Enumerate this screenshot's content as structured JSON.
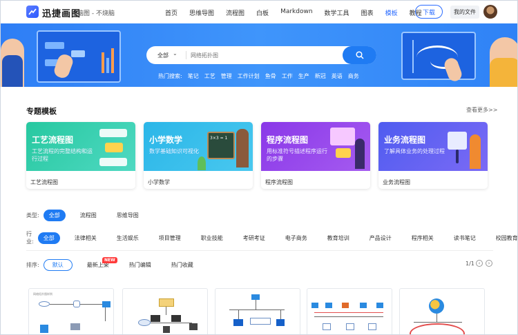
{
  "header": {
    "brand": "迅捷画图",
    "slogan": "脑图 - 不烧脑",
    "nav": [
      "首页",
      "思维导图",
      "流程图",
      "白板",
      "Markdown",
      "数学工具",
      "图表",
      "模板",
      "教程"
    ],
    "active_nav": "模板",
    "download_label": "下载",
    "my_files_label": "我的文件"
  },
  "search": {
    "scope": "全部",
    "placeholder": "网络拓扑图",
    "hot_label": "热门搜索:",
    "hot_tags": [
      "笔记",
      "工艺",
      "管理",
      "工作计划",
      "鱼骨",
      "工作",
      "生产",
      "新冠",
      "英语",
      "商务"
    ]
  },
  "section": {
    "title": "专题模板",
    "more": "查看更多>>"
  },
  "cards": [
    {
      "title": "工艺流程图",
      "desc": "工艺流程的完整结构和运行过程",
      "caption": "工艺流程图"
    },
    {
      "title": "小学数学",
      "desc": "数学基础知识可视化",
      "caption": "小学数学"
    },
    {
      "title": "程序流程图",
      "desc": "用标准符号描述程序运行的步骤",
      "caption": "程序流程图"
    },
    {
      "title": "业务流程图",
      "desc": "了解具体业务的处理过程",
      "caption": "业务流程图"
    }
  ],
  "filters": {
    "type_label": "类型:",
    "types": [
      "全部",
      "流程图",
      "思维导图"
    ],
    "industry_label": "行业:",
    "industries": [
      "全部",
      "法律相关",
      "生活娱乐",
      "项目管理",
      "职业技能",
      "考研考证",
      "电子商务",
      "教育培训",
      "产品设计",
      "程序相关",
      "读书笔记",
      "校园教育"
    ],
    "sort_label": "排序:",
    "sorts": [
      "默认",
      "最新上架",
      "热门编辑",
      "热门收藏"
    ],
    "new_badge": "NEW",
    "pager": "1/1"
  },
  "thumb_caption": "网络拓扑图样例",
  "chalkboard": "3×3 = 1"
}
